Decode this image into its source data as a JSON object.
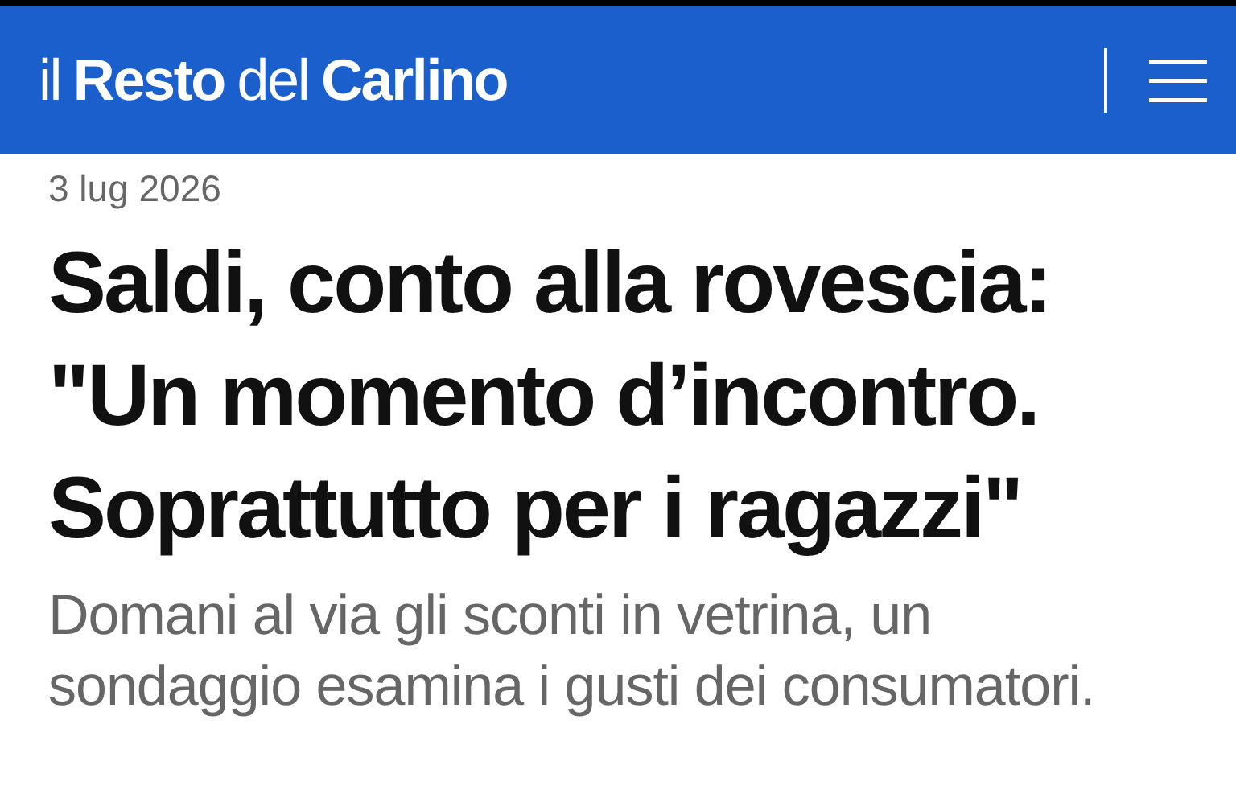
{
  "header": {
    "logo": "il **Resto** del **Carlino**"
  },
  "article": {
    "date": "3 lug 2026",
    "headline": "Saldi, conto alla rovescia: \"Un momento d’incontro. Soprattutto per i ragazzi\"",
    "subtitle": "Domani al via gli sconti in vetrina, un sondaggio esamina i gusti dei consumatori."
  }
}
